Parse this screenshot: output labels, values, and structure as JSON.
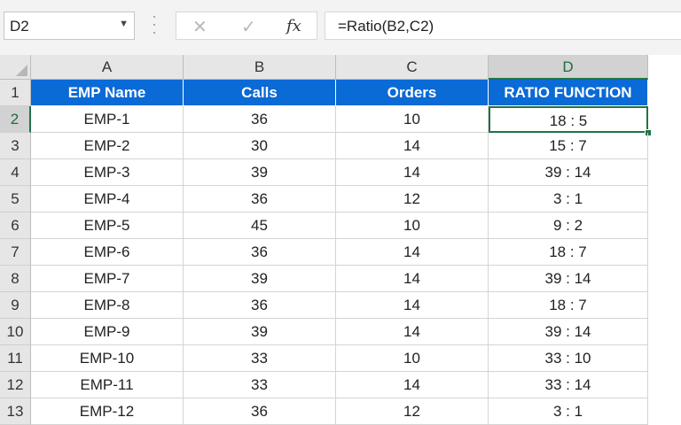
{
  "name_box": {
    "value": "D2",
    "dropdown_icon": "chevron-down-icon"
  },
  "formula_bar": {
    "cancel_icon": "✕",
    "enter_icon": "✓",
    "fx_label": "fx",
    "formula": "=Ratio(B2,C2)"
  },
  "columns": [
    "A",
    "B",
    "C",
    "D"
  ],
  "rows": [
    "1",
    "2",
    "3",
    "4",
    "5",
    "6",
    "7",
    "8",
    "9",
    "10",
    "11",
    "12",
    "13"
  ],
  "header": {
    "a": "EMP Name",
    "b": "Calls",
    "c": "Orders",
    "d": "RATIO FUNCTION"
  },
  "data": [
    {
      "a": "EMP-1",
      "b": "36",
      "c": "10",
      "d": "18 : 5"
    },
    {
      "a": "EMP-2",
      "b": "30",
      "c": "14",
      "d": "15 : 7"
    },
    {
      "a": "EMP-3",
      "b": "39",
      "c": "14",
      "d": "39 : 14"
    },
    {
      "a": "EMP-4",
      "b": "36",
      "c": "12",
      "d": "3 : 1"
    },
    {
      "a": "EMP-5",
      "b": "45",
      "c": "10",
      "d": "9 : 2"
    },
    {
      "a": "EMP-6",
      "b": "36",
      "c": "14",
      "d": "18 : 7"
    },
    {
      "a": "EMP-7",
      "b": "39",
      "c": "14",
      "d": "39 : 14"
    },
    {
      "a": "EMP-8",
      "b": "36",
      "c": "14",
      "d": "18 : 7"
    },
    {
      "a": "EMP-9",
      "b": "39",
      "c": "14",
      "d": "39 : 14"
    },
    {
      "a": "EMP-10",
      "b": "33",
      "c": "10",
      "d": "33 : 10"
    },
    {
      "a": "EMP-11",
      "b": "33",
      "c": "14",
      "d": "33 : 14"
    },
    {
      "a": "EMP-12",
      "b": "36",
      "c": "12",
      "d": "3 : 1"
    }
  ],
  "selected_cell": "D2",
  "colors": {
    "header_fill": "#0a6ad6",
    "selection": "#217346"
  }
}
